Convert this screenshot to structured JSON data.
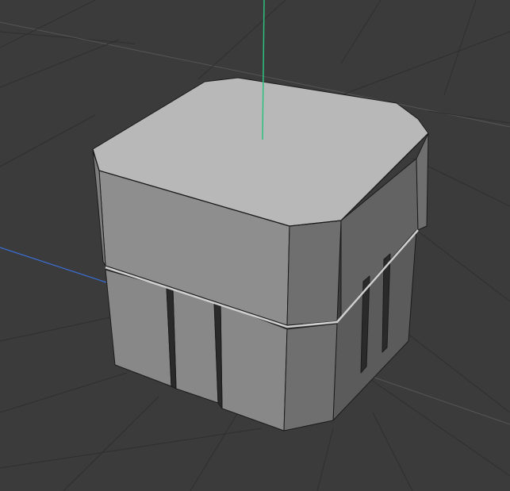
{
  "viewport": {
    "background_color": "#3b3b3b",
    "grid_color": "#2f2f2f",
    "grid_highlight_color": "#555555"
  },
  "axes": {
    "y_axis_color": "#2fbf7f",
    "x_axis_color": "#3a6fd6"
  },
  "mesh": {
    "object_kind": "beveled-cube",
    "shading": {
      "top": "#b8b8b8",
      "top_bevel": "#a9a9a9",
      "front": "#8e8e8e",
      "front_lower": "#888888",
      "right": "#636363",
      "right_lower": "#5b5b5b",
      "right_bevel": "#6f6f6f",
      "left_bevel": "#7d7d7d",
      "groove": "#2a2a2a",
      "seam_highlight": "#cfcfcf"
    }
  }
}
